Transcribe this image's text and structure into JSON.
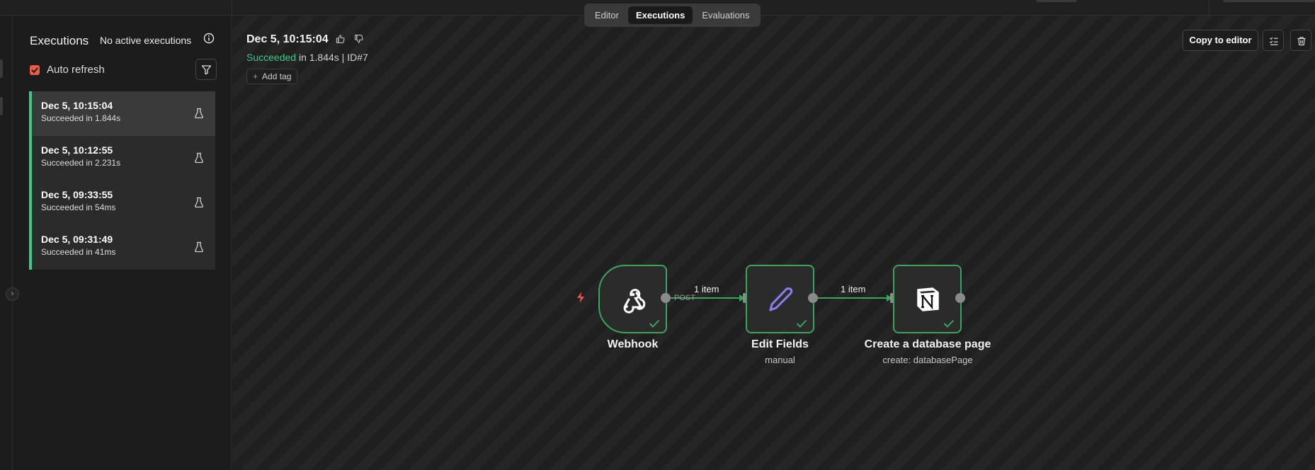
{
  "header": {
    "tabs": [
      {
        "label": "Editor",
        "active": false
      },
      {
        "label": "Executions",
        "active": true
      },
      {
        "label": "Evaluations",
        "active": false
      }
    ]
  },
  "sidebar": {
    "title": "Executions",
    "status": "No active executions",
    "auto_refresh": {
      "label": "Auto refresh",
      "checked": true
    },
    "executions": [
      {
        "time": "Dec 5, 10:15:04",
        "status": "Succeeded in 1.844s",
        "selected": true
      },
      {
        "time": "Dec 5, 10:12:55",
        "status": "Succeeded in 2.231s",
        "selected": false
      },
      {
        "time": "Dec 5, 09:33:55",
        "status": "Succeeded in 54ms",
        "selected": false
      },
      {
        "time": "Dec 5, 09:31:49",
        "status": "Succeeded in 41ms",
        "selected": false
      }
    ]
  },
  "execution": {
    "title": "Dec 5, 10:15:04",
    "status_word": "Succeeded",
    "duration": " in 1.844s | ID#7",
    "add_tag_label": "Add tag",
    "copy_button_label": "Copy to editor"
  },
  "workflow": {
    "nodes": [
      {
        "name": "Webhook",
        "subtitle": "",
        "icon": "webhook-icon"
      },
      {
        "name": "Edit Fields",
        "subtitle": "manual",
        "icon": "pencil-icon"
      },
      {
        "name": "Create a database page",
        "subtitle": "create: databasePage",
        "icon": "notion-icon"
      }
    ],
    "edges": [
      {
        "label": "1 item",
        "method": "POST"
      },
      {
        "label": "1 item"
      }
    ]
  },
  "colors": {
    "success": "#3ec98a",
    "node_border": "#3aa55d",
    "checkbox": "#ea5a45",
    "trigger_bolt": "#ea5a45"
  }
}
